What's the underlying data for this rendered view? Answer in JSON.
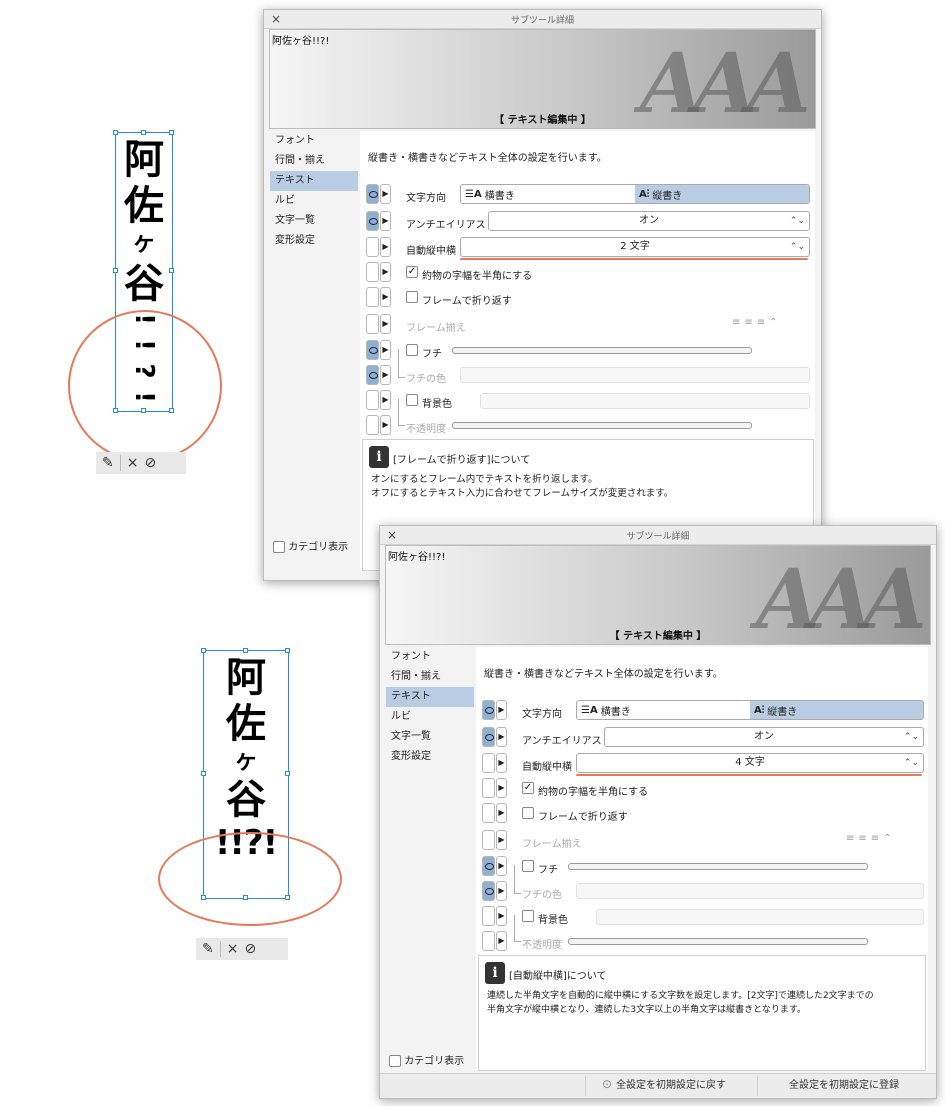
{
  "colors": {
    "accent": "#e6795a",
    "selection": "#b8cde3",
    "frame_border": "#2a8adf"
  },
  "canvas_top": {
    "chars": [
      "阿",
      "佐",
      "ヶ",
      "谷",
      "!",
      "!",
      "?",
      "!"
    ],
    "toolbar": {
      "edit_icon": "pencil-icon",
      "cancel": "×",
      "confirm": "⊘"
    }
  },
  "canvas_bottom": {
    "chars": [
      "阿",
      "佐",
      "ヶ",
      "谷"
    ],
    "tcy": "!!?!",
    "toolbar": {
      "edit_icon": "pencil-icon",
      "cancel": "×",
      "confirm": "⊘"
    }
  },
  "dialog1": {
    "title": "サブツール詳細",
    "close": "×",
    "preview_text": "阿佐ヶ谷!!?!",
    "preview_big": "AAA",
    "status": "【 テキスト編集中 】",
    "categories": [
      "フォント",
      "行間・揃え",
      "テキスト",
      "ルビ",
      "文字一覧",
      "変形設定"
    ],
    "selected_category": "テキスト",
    "description": "縦書き・横書きなどテキスト全体の設定を行います。",
    "direction_label": "文字方向",
    "direction_h": "横書き",
    "direction_v": "縦書き",
    "antialias_label": "アンチエイリアス",
    "antialias_value": "オン",
    "tcy_label": "自動縦中横",
    "tcy_value": "2 文字",
    "halfwidth_label": "約物の字幅を半角にする",
    "wrap_label": "フレームで折り返す",
    "frame_align_label": "フレーム揃え",
    "edge_label": "フチ",
    "edge_color_label": "フチの色",
    "bg_label": "背景色",
    "opacity_label": "不透明度",
    "info_title": "[フレームで折り返す]について",
    "info_body": "オンにするとフレーム内でテキストを折り返します。\nオフにするとテキスト入力に合わせてフレームサイズが変更されます。",
    "category_show": "カテゴリ表示"
  },
  "dialog2": {
    "title": "サブツール詳細",
    "close": "×",
    "preview_text": "阿佐ヶ谷!!?!",
    "preview_big": "AAA",
    "status": "【 テキスト編集中 】",
    "categories": [
      "フォント",
      "行間・揃え",
      "テキスト",
      "ルビ",
      "文字一覧",
      "変形設定"
    ],
    "selected_category": "テキスト",
    "description": "縦書き・横書きなどテキスト全体の設定を行います。",
    "direction_label": "文字方向",
    "direction_h": "横書き",
    "direction_v": "縦書き",
    "antialias_label": "アンチエイリアス",
    "antialias_value": "オン",
    "tcy_label": "自動縦中横",
    "tcy_value": "4 文字",
    "halfwidth_label": "約物の字幅を半角にする",
    "wrap_label": "フレームで折り返す",
    "frame_align_label": "フレーム揃え",
    "edge_label": "フチ",
    "edge_color_label": "フチの色",
    "bg_label": "背景色",
    "opacity_label": "不透明度",
    "info_title": "[自動縦中横]について",
    "info_body": "連続した半角文字を自動的に縦中横にする文字数を設定します。[2文字]で連続した2文字までの\n半角文字が縦中横となり、連続した3文字以上の半角文字は縦書きとなります。",
    "category_show": "カテゴリ表示",
    "reset_all": "全設定を初期設定に戻す",
    "register_all": "全設定を初期設定に登録"
  }
}
